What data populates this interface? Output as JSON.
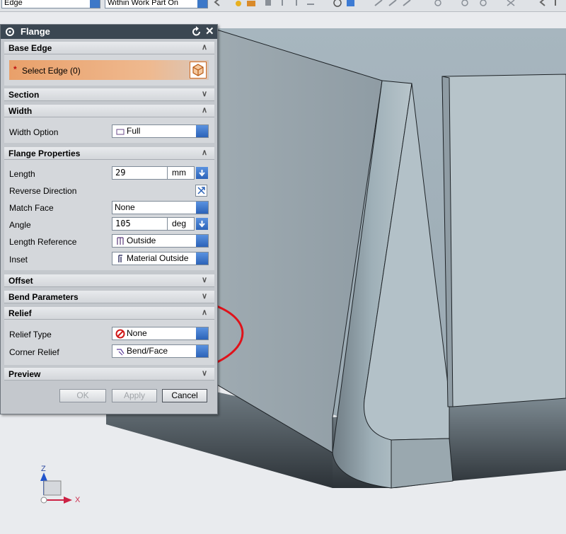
{
  "toolbar": {
    "filter_combo": "Edge",
    "scope_combo": "Within Work Part On"
  },
  "dialog": {
    "title": "Flange",
    "sections": {
      "base_edge": "Base Edge",
      "section": "Section",
      "width": "Width",
      "flange_properties": "Flange Properties",
      "offset": "Offset",
      "bend_parameters": "Bend Parameters",
      "relief": "Relief",
      "preview": "Preview"
    },
    "select_edge": {
      "required_mark": "*",
      "label": "Select Edge (0)"
    },
    "width_option": {
      "label": "Width Option",
      "value": "Full"
    },
    "length": {
      "label": "Length",
      "value": "29",
      "unit": "mm"
    },
    "reverse_direction": {
      "label": "Reverse Direction"
    },
    "match_face": {
      "label": "Match Face",
      "value": "None"
    },
    "angle": {
      "label": "Angle",
      "value": "105",
      "unit": "deg"
    },
    "length_reference": {
      "label": "Length Reference",
      "value": "Outside"
    },
    "inset": {
      "label": "Inset",
      "value": "Material Outside"
    },
    "relief_type": {
      "label": "Relief Type",
      "value": "None"
    },
    "corner_relief": {
      "label": "Corner Relief",
      "value": "Bend/Face"
    },
    "buttons": {
      "ok": "OK",
      "apply": "Apply",
      "cancel": "Cancel"
    }
  },
  "triad": {
    "z_label": "Z",
    "x_label": "X"
  },
  "colors": {
    "title_bar": "#3b4752",
    "select_edge_highlight": "#e9a06a",
    "annotation": "#e0121a",
    "accent_blue": "#2c63b8"
  }
}
